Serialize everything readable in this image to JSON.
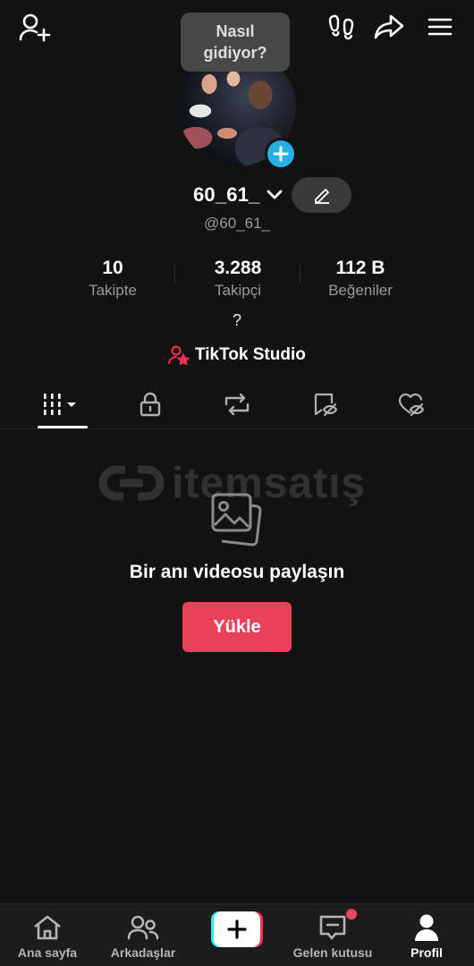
{
  "tooltip": {
    "line1": "Nasıl",
    "line2": "gidiyor?"
  },
  "profile": {
    "username": "60_61_",
    "handle": "@60_61_",
    "bio": "?"
  },
  "stats": [
    {
      "value": "10",
      "label": "Takipte"
    },
    {
      "value": "3.288",
      "label": "Takipçi"
    },
    {
      "value": "112 B",
      "label": "Beğeniler"
    }
  ],
  "studio": {
    "label": "TikTok Studio"
  },
  "tabs": [
    {
      "icon": "grid-icon"
    },
    {
      "icon": "lock-icon"
    },
    {
      "icon": "repost-icon"
    },
    {
      "icon": "bookmark-icon"
    },
    {
      "icon": "liked-icon"
    }
  ],
  "watermark": {
    "text": "itemsatış"
  },
  "empty_state": {
    "title": "Bir anı videosu paylaşın",
    "button": "Yükle"
  },
  "nav": {
    "home": "Ana sayfa",
    "friends": "Arkadaşlar",
    "inbox": "Gelen kutusu",
    "profile": "Profil"
  },
  "colors": {
    "background": "#121212",
    "accent": "#e9415a",
    "avatar_badge": "#25b1e6",
    "notification_dot": "#f0435e",
    "studio_icon": "#fe2c55"
  }
}
